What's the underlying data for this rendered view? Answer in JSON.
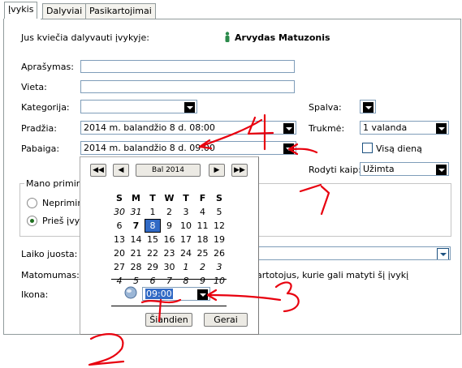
{
  "tabs": [
    "Įvykis",
    "Dalyviai",
    "Pasikartojimai"
  ],
  "invite_label": "Jus kviečia dalyvauti įvykyje:",
  "organizer": "Arvydas Matuzonis",
  "labels": {
    "description": "Aprašymas:",
    "location": "Vieta:",
    "category": "Kategorija:",
    "start": "Pradžia:",
    "end": "Pabaiga:",
    "color": "Spalva:",
    "duration": "Trukmė:",
    "all_day": "Visą dieną",
    "show_as": "Rodyti kaip:",
    "reminders": "Mano priminim",
    "no_reminder": "Nepriminti",
    "before_event": "Prieš įvyk",
    "time_strip": "Laiko juosta:",
    "visibility": "Matomumas:",
    "visibility_text": "artotojus, kurie gali matyti šį įvykį",
    "icon": "Ikona:"
  },
  "values": {
    "start": "2014 m. balandžio 8 d. 08:00",
    "end": "2014 m. balandžio 8 d. 09:00",
    "duration": "1 valanda",
    "show_as": "Užimta"
  },
  "calendar": {
    "month_label": "Bal 2014",
    "weekdays": [
      "S",
      "M",
      "T",
      "W",
      "T",
      "F",
      "S"
    ],
    "weeks": [
      [
        {
          "d": "30",
          "o": 1
        },
        {
          "d": "31",
          "o": 1
        },
        {
          "d": "1"
        },
        {
          "d": "2"
        },
        {
          "d": "3"
        },
        {
          "d": "4"
        },
        {
          "d": "5"
        }
      ],
      [
        {
          "d": "6"
        },
        {
          "d": "7",
          "b": 1
        },
        {
          "d": "8",
          "s": 1
        },
        {
          "d": "9"
        },
        {
          "d": "10"
        },
        {
          "d": "11"
        },
        {
          "d": "12"
        }
      ],
      [
        {
          "d": "13"
        },
        {
          "d": "14"
        },
        {
          "d": "15"
        },
        {
          "d": "16"
        },
        {
          "d": "17"
        },
        {
          "d": "18"
        },
        {
          "d": "19"
        }
      ],
      [
        {
          "d": "20"
        },
        {
          "d": "21"
        },
        {
          "d": "22"
        },
        {
          "d": "23"
        },
        {
          "d": "24"
        },
        {
          "d": "25"
        },
        {
          "d": "26"
        }
      ],
      [
        {
          "d": "27"
        },
        {
          "d": "28"
        },
        {
          "d": "29"
        },
        {
          "d": "30"
        },
        {
          "d": "1",
          "o": 1
        },
        {
          "d": "2",
          "o": 1
        },
        {
          "d": "3",
          "o": 1
        }
      ],
      [
        {
          "d": "4",
          "o": 1
        },
        {
          "d": "5",
          "o": 1
        },
        {
          "d": "6",
          "o": 1
        },
        {
          "d": "7",
          "o": 1
        },
        {
          "d": "8",
          "o": 1
        },
        {
          "d": "9",
          "o": 1
        },
        {
          "d": "10",
          "o": 1
        }
      ]
    ],
    "time": "09:00",
    "today_button": "Šiandien",
    "ok_button": "Gerai"
  },
  "annotations": [
    "1",
    "2",
    "3",
    "4"
  ],
  "colors": {
    "annotation": "#e8000e",
    "selection": "#316ac5",
    "border": "#7f9db9"
  }
}
